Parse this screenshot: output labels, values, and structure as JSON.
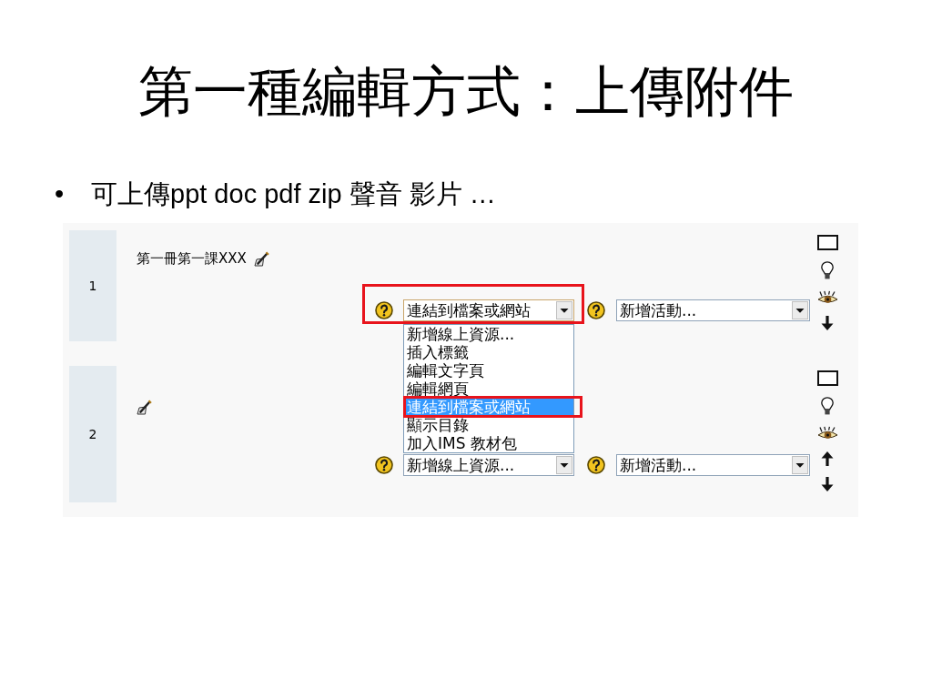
{
  "slide": {
    "title": "第一種編輯方式：上傳附件",
    "bullets": [
      {
        "marker": "•",
        "text": "可上傳ppt doc pdf zip 聲音 影片 …"
      }
    ]
  },
  "course_sections": [
    {
      "number": "1",
      "title": "第一冊第一課XXX",
      "resource_select": {
        "value": "連結到檔案或網站",
        "focused": true,
        "annotated": true,
        "menu": {
          "items": [
            {
              "label": "新增線上資源...",
              "selected": false,
              "annotated": false
            },
            {
              "label": "插入標籤",
              "selected": false,
              "annotated": false
            },
            {
              "label": "編輯文字頁",
              "selected": false,
              "annotated": false
            },
            {
              "label": "編輯網頁",
              "selected": false,
              "annotated": false
            },
            {
              "label": "連結到檔案或網站",
              "selected": true,
              "annotated": true
            },
            {
              "label": "顯示目錄",
              "selected": false,
              "annotated": false
            },
            {
              "label": "加入IMS 教材包",
              "selected": false,
              "annotated": false
            }
          ]
        }
      },
      "activity_select": {
        "value": "新增活動..."
      },
      "move_down": true
    },
    {
      "number": "2",
      "resource_select": {
        "value": "新增線上資源...",
        "focused": false
      },
      "activity_select": {
        "value": "新增活動..."
      },
      "move_up": true,
      "move_down": true
    }
  ]
}
